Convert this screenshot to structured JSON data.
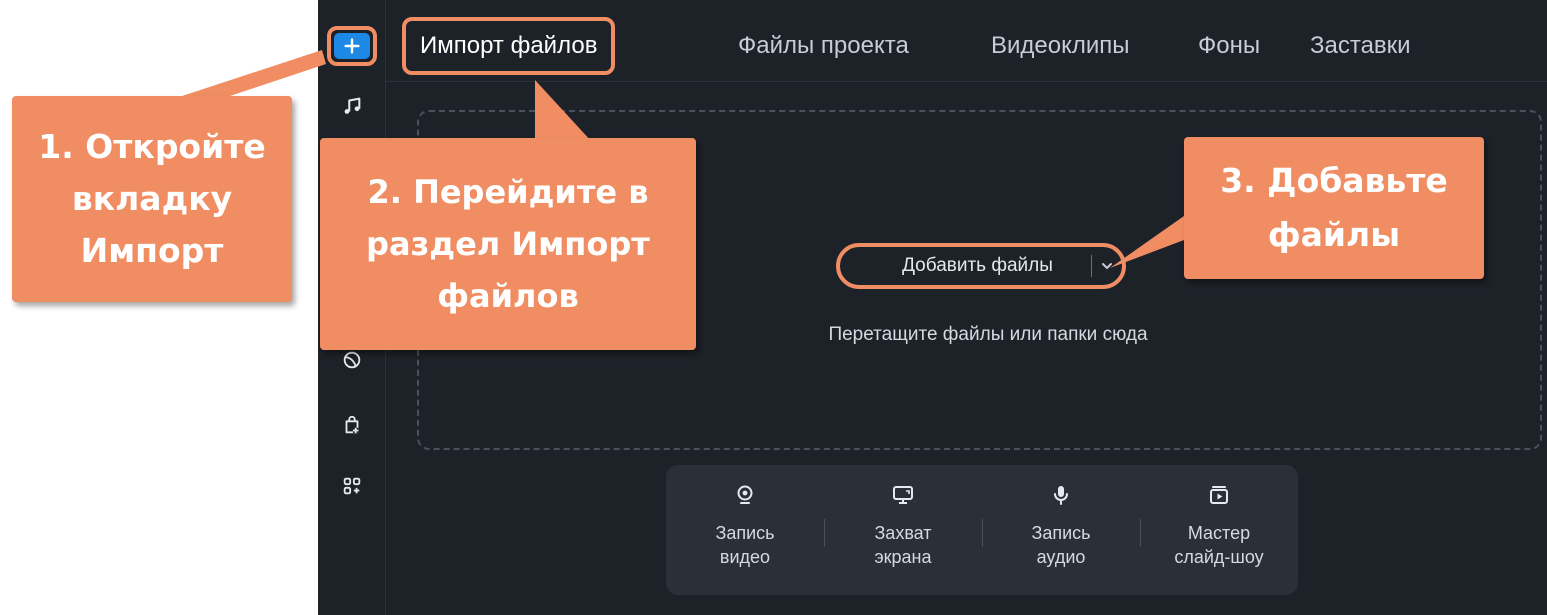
{
  "tabs": [
    {
      "label": "Импорт файлов",
      "active": true
    },
    {
      "label": "Файлы проекта",
      "active": false
    },
    {
      "label": "Видеоклипы",
      "active": false
    },
    {
      "label": "Фоны",
      "active": false
    },
    {
      "label": "Заставки",
      "active": false
    }
  ],
  "sidebar": {
    "items": [
      {
        "icon": "plus-icon",
        "active": true
      },
      {
        "icon": "music-note-icon"
      },
      {
        "icon": "filter-icon"
      },
      {
        "icon": "bag-add-icon"
      },
      {
        "icon": "apps-add-icon"
      }
    ]
  },
  "dropzone": {
    "add_button_label": "Добавить файлы",
    "hint": "Перетащите файлы или папки сюда"
  },
  "record_toolbar": [
    {
      "icon": "webcam-icon",
      "label": "Запись\nвидео"
    },
    {
      "icon": "monitor-icon",
      "label": "Захват\nэкрана"
    },
    {
      "icon": "microphone-icon",
      "label": "Запись\nаудио"
    },
    {
      "icon": "slideshow-icon",
      "label": "Мастер\nслайд-шоу"
    }
  ],
  "callouts": {
    "step1": "1. Откройте\nвкладку\nИмпорт",
    "step2": "2. Перейдите в\nраздел Импорт\nфайлов",
    "step3": "3. Добавьте\nфайлы"
  },
  "colors": {
    "callout": "#f08d63",
    "app_bg": "#1d2128",
    "accent": "#1e88e5"
  }
}
